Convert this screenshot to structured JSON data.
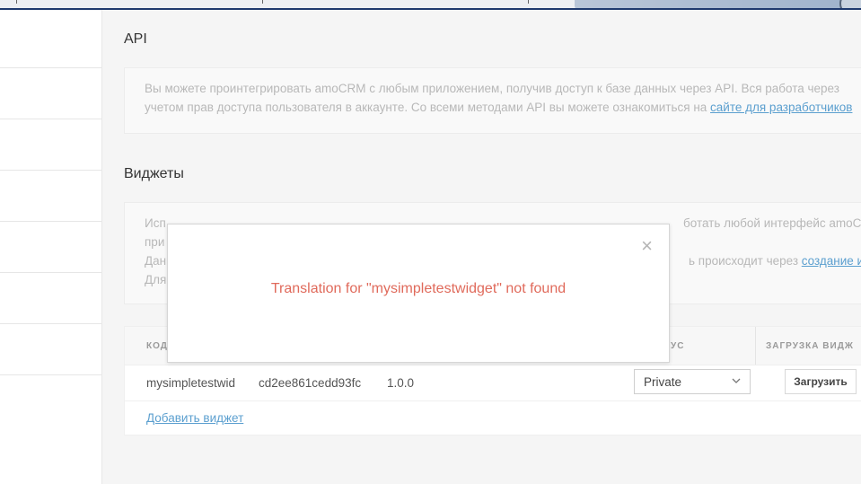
{
  "api": {
    "title": "API",
    "line1": "Вы можете проинтегрировать amoCRM с любым приложением, получив доступ к базе данных через API. Вся работа через",
    "line2_prefix": "учетом прав доступа пользователя в аккаунте. Со всеми методами API вы можете ознакомиться на ",
    "line2_link": "сайте для разработчиков"
  },
  "widgets": {
    "title": "Виджеты",
    "line1_start": "Исп",
    "line1_end": "ботать любой интерфейс amoCRM",
    "line2_start": "при",
    "line3_start": "Дан",
    "line3_end": "ь происходит через ",
    "line3_link": "создание ин",
    "line4_start": "Для",
    "table": {
      "headers": [
        "КОД",
        "УС",
        "ЗАГРУЗКА ВИДЖ"
      ],
      "row": {
        "code": "mysimpletestwid",
        "secret": "cd2ee861cedd93fc",
        "version": "1.0.0",
        "status": "Private",
        "upload_button": "Загрузить"
      },
      "add_link": "Добавить виджет"
    }
  },
  "modal": {
    "close": "×",
    "message": "Translation for \"mysimpletestwidget\" not found"
  },
  "colors": {
    "error_text": "#e06a5b",
    "link": "#5b9fcf"
  }
}
